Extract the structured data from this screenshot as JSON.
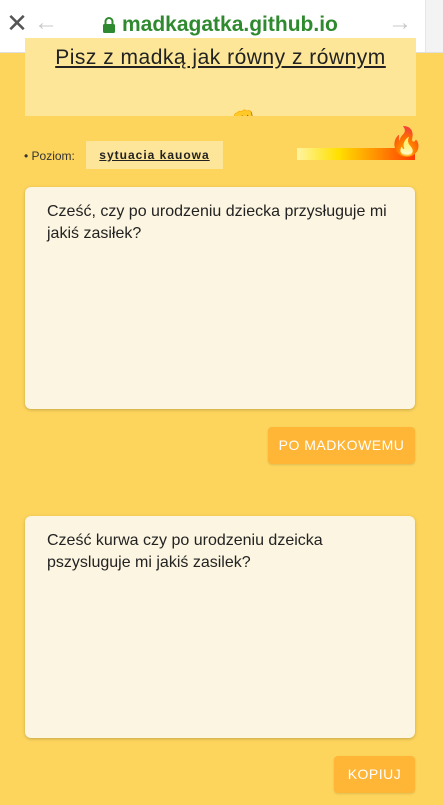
{
  "browser": {
    "url": "madkagatka.github.io",
    "icons": {
      "close": "close-icon",
      "back": "back-arrow-icon",
      "forward": "forward-arrow-icon",
      "lock": "lock-icon"
    }
  },
  "header": {
    "title": "Pisz z madką jak równy z równym",
    "emoji": "👊"
  },
  "level": {
    "label": "• Poziom:",
    "value": "sytuacia kauowa",
    "slider_level": 1.0,
    "fire_emoji": "🔥"
  },
  "input": {
    "text": "Cześć, czy po urodzeniu dziecka przysługuje mi jakiś zasiłek?"
  },
  "convert_button": {
    "label": "PO MADKOWEMU"
  },
  "output": {
    "text": "Cześć kurwa czy po  urodzeniu dzeicka pszysluguje mi jakiś zasilek?"
  },
  "copy_button": {
    "label": "KOPIUJ"
  },
  "colors": {
    "background": "#fdd55c",
    "card": "#fde698",
    "textarea": "#fcf5e1",
    "button": "#ffb536",
    "url_green": "#2f8a2f"
  }
}
